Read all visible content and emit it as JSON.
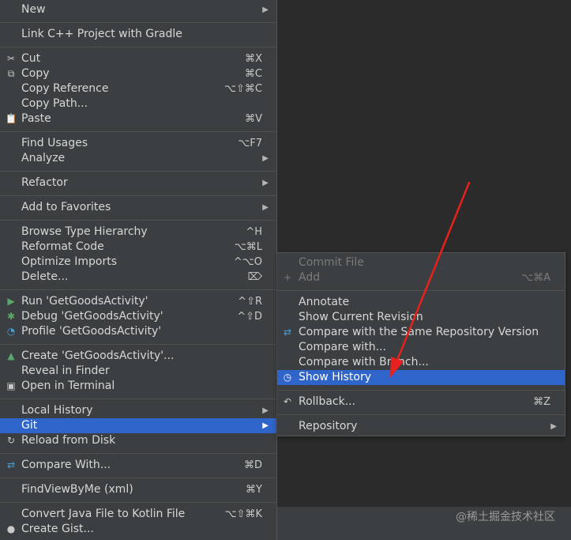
{
  "main_menu": {
    "new": {
      "label": "New"
    },
    "link_cpp": {
      "label": "Link C++ Project with Gradle"
    },
    "cut": {
      "label": "Cut",
      "shortcut": "⌘X"
    },
    "copy": {
      "label": "Copy",
      "shortcut": "⌘C"
    },
    "copy_reference": {
      "label": "Copy Reference",
      "shortcut": "⌥⇧⌘C"
    },
    "copy_path": {
      "label": "Copy Path..."
    },
    "paste": {
      "label": "Paste",
      "shortcut": "⌘V"
    },
    "find_usages": {
      "label": "Find Usages",
      "shortcut": "⌥F7"
    },
    "analyze": {
      "label": "Analyze"
    },
    "refactor": {
      "label": "Refactor"
    },
    "add_to_favorites": {
      "label": "Add to Favorites"
    },
    "browse_type_hierarchy": {
      "label": "Browse Type Hierarchy",
      "shortcut": "^H"
    },
    "reformat_code": {
      "label": "Reformat Code",
      "shortcut": "⌥⌘L"
    },
    "optimize_imports": {
      "label": "Optimize Imports",
      "shortcut": "^⌥O"
    },
    "delete": {
      "label": "Delete...",
      "shortcut": "⌦"
    },
    "run": {
      "label": "Run 'GetGoodsActivity'",
      "shortcut": "^⇧R"
    },
    "debug": {
      "label": "Debug 'GetGoodsActivity'",
      "shortcut": "^⇧D"
    },
    "profile": {
      "label": "Profile 'GetGoodsActivity'"
    },
    "create": {
      "label": "Create 'GetGoodsActivity'..."
    },
    "reveal": {
      "label": "Reveal in Finder"
    },
    "open_terminal": {
      "label": "Open in Terminal"
    },
    "local_history": {
      "label": "Local History"
    },
    "git": {
      "label": "Git"
    },
    "reload": {
      "label": "Reload from Disk"
    },
    "compare_with": {
      "label": "Compare With...",
      "shortcut": "⌘D"
    },
    "findviewbyme": {
      "label": "FindViewByMe (xml)",
      "shortcut": "⌘Y"
    },
    "convert_kotlin": {
      "label": "Convert Java File to Kotlin File",
      "shortcut": "⌥⇧⌘K"
    },
    "create_gist": {
      "label": "Create Gist..."
    }
  },
  "git_submenu": {
    "commit_file": {
      "label": "Commit File"
    },
    "add": {
      "label": "Add",
      "shortcut": "⌥⌘A"
    },
    "annotate": {
      "label": "Annotate"
    },
    "show_current_revision": {
      "label": "Show Current Revision"
    },
    "compare_same_repo": {
      "label": "Compare with the Same Repository Version"
    },
    "compare_with": {
      "label": "Compare with..."
    },
    "compare_branch": {
      "label": "Compare with Branch..."
    },
    "show_history": {
      "label": "Show History"
    },
    "rollback": {
      "label": "Rollback...",
      "shortcut": "⌘Z"
    },
    "repository": {
      "label": "Repository"
    }
  },
  "watermark": "@稀土掘金技术社区",
  "colors": {
    "menu_bg": "#3c3f41",
    "selection": "#2f65ca",
    "annotation_arrow": "#e8201e",
    "run_icon": "#59a869",
    "debug_icon": "#59a869",
    "compare_icon": "#4a9fd8"
  }
}
